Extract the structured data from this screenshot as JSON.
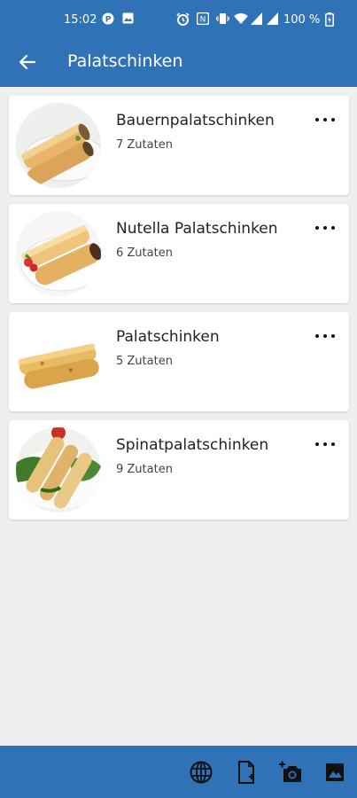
{
  "status_bar": {
    "time": "15:02",
    "battery_percent": "100 %",
    "icons": [
      "notification-icon",
      "image-icon",
      "alarm-icon",
      "nfc-icon",
      "vibrate-icon",
      "wifi-icon",
      "signal-icon",
      "signal-icon",
      "battery-icon"
    ]
  },
  "app_bar": {
    "title": "Palatschinken",
    "back_icon": "arrow-back-icon"
  },
  "recipes": [
    {
      "name": "Bauernpalatschinken",
      "ingredients": "7 Zutaten",
      "menu_icon": "more-horizontal-icon"
    },
    {
      "name": "Nutella Palatschinken",
      "ingredients": "6 Zutaten",
      "menu_icon": "more-horizontal-icon"
    },
    {
      "name": "Palatschinken",
      "ingredients": "5 Zutaten",
      "menu_icon": "more-horizontal-icon"
    },
    {
      "name": "Spinatpalatschinken",
      "ingredients": "9 Zutaten",
      "menu_icon": "more-horizontal-icon"
    }
  ],
  "bottom_bar": {
    "icons": [
      "globe-icon",
      "add-document-icon",
      "add-photo-icon",
      "image-gallery-icon"
    ]
  },
  "colors": {
    "primary": "#2f72b6",
    "background": "#efefef",
    "card": "#ffffff"
  }
}
